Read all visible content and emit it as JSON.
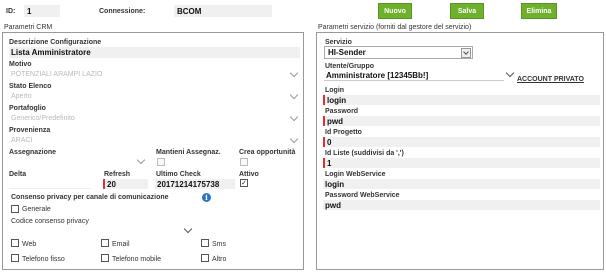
{
  "header": {
    "id_label": "ID:",
    "id_value": "1",
    "connection_label": "Connessione:",
    "connection_value": "BCOM",
    "buttons": {
      "new": "Nuovo",
      "save": "Salva",
      "delete": "Elimina"
    }
  },
  "crm": {
    "title": "Parametri CRM",
    "description_label": "Descrizione Configurazione",
    "description_value": "Lista Amministratore",
    "reason_label": "Motivo",
    "reason_value": "POTENZIALI ARAMPI LAZIO",
    "list_status_label": "Stato Elenco",
    "list_status_value": "Aperto",
    "portfolio_label": "Portafoglio",
    "portfolio_value": "Generico/Predefinito",
    "origin_label": "Provenienza",
    "origin_value": "ARACI",
    "assignment_label": "Assegnazione",
    "keep_assignment_label": "Mantieni Assegnaz.",
    "create_opportunity_label": "Crea opportunità",
    "delta_label": "Delta",
    "refresh_label": "Refresh",
    "refresh_value": "20",
    "last_check_label": "Ultimo Check",
    "last_check_value": "20171214175738",
    "active_label": "Attivo",
    "active_checked": "✓",
    "privacy_title": "Consenso privacy per canale di comunicazione",
    "general_label": "Generale",
    "privacy_code_label": "Codice consenso privacy",
    "channels": [
      "Web",
      "Email",
      "Sms",
      "Telefono fisso",
      "Telefono mobile",
      "Altro"
    ]
  },
  "service": {
    "title": "Parametri servizio (forniti dal gestore del servizio)",
    "service_label": "Servizio",
    "service_value": "HI-Sender",
    "user_group_label": "Utente/Gruppo",
    "user_group_value": "Amministratore [12345Bb!]",
    "private_account_link": "ACCOUNT PRIVATO",
    "login_label": "Login",
    "login_value": "login",
    "password_label": "Password",
    "password_value": "pwd",
    "project_id_label": "Id Progetto",
    "project_id_value": "0",
    "list_id_label": "Id Liste (suddivisi da ',')",
    "list_id_value": "1",
    "login_ws_label": "Login WebService",
    "login_ws_value": "login",
    "password_ws_label": "Password WebService",
    "password_ws_value": "pwd"
  },
  "colors": {
    "accent_green": "#6fb02c",
    "required_red": "#e03030",
    "info_blue": "#2a73c9"
  }
}
